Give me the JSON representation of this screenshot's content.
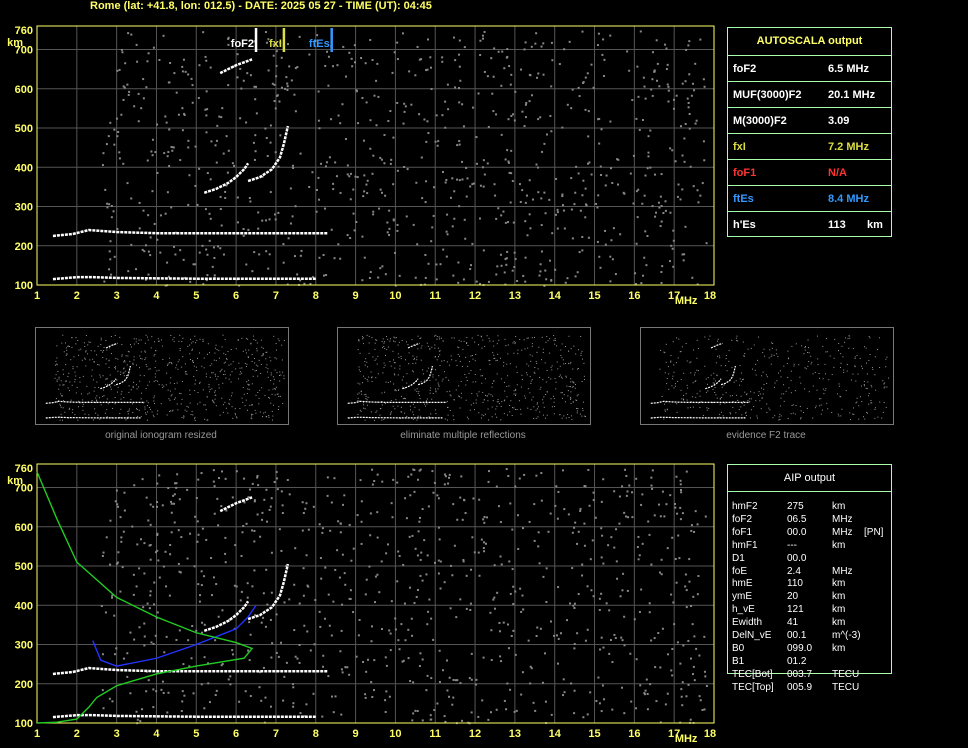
{
  "header": {
    "title": "Rome (lat: +41.8, lon: 012.5) - DATE: 2025 05 27 - TIME (UT): 04:45"
  },
  "autoscala": {
    "title": "AUTOSCALA output",
    "rows": [
      {
        "label": "foF2",
        "value": "6.5 MHz",
        "color": "#ffffff"
      },
      {
        "label": "MUF(3000)F2",
        "value": "20.1 MHz",
        "color": "#ffffff"
      },
      {
        "label": "M(3000)F2",
        "value": "3.09",
        "color": "#ffffff"
      },
      {
        "label": "fxI",
        "value": "7.2 MHz",
        "color": "#dddd44"
      },
      {
        "label": "foF1",
        "value": "N/A",
        "color": "#ff3333"
      },
      {
        "label": "ftEs",
        "value": "8.4 MHz",
        "color": "#3399ff"
      },
      {
        "label": "h'Es",
        "value": "113",
        "unit": "km",
        "color": "#ffffff"
      }
    ]
  },
  "aip": {
    "title": "AIP output",
    "rows": [
      {
        "name": "hmF2",
        "value": "275",
        "unit": "km",
        "extra": ""
      },
      {
        "name": "foF2",
        "value": "06.5",
        "unit": "MHz",
        "extra": ""
      },
      {
        "name": "foF1",
        "value": "00.0",
        "unit": "MHz",
        "extra": "[PN]"
      },
      {
        "name": "hmF1",
        "value": "---",
        "unit": "km",
        "extra": ""
      },
      {
        "name": "D1",
        "value": "00.0",
        "unit": "",
        "extra": ""
      },
      {
        "name": "foE",
        "value": "2.4",
        "unit": "MHz",
        "extra": ""
      },
      {
        "name": "hmE",
        "value": "110",
        "unit": "km",
        "extra": ""
      },
      {
        "name": "ymE",
        "value": "20",
        "unit": "km",
        "extra": ""
      },
      {
        "name": "h_vE",
        "value": "121",
        "unit": "km",
        "extra": ""
      },
      {
        "name": "Ewidth",
        "value": "41",
        "unit": "km",
        "extra": ""
      },
      {
        "name": "DelN_vE",
        "value": "00.1",
        "unit": "m^(-3)",
        "extra": ""
      },
      {
        "name": "B0",
        "value": "099.0",
        "unit": "km",
        "extra": ""
      },
      {
        "name": "B1",
        "value": "01.2",
        "unit": "",
        "extra": ""
      },
      {
        "name": "TEC[Bot]",
        "value": "003.7",
        "unit": "TECU",
        "extra": ""
      },
      {
        "name": "TEC[Top]",
        "value": "005.9",
        "unit": "TECU",
        "extra": ""
      }
    ]
  },
  "thumbnails": [
    {
      "caption": "original ionogram resized"
    },
    {
      "caption": "eliminate multiple reflections"
    },
    {
      "caption": "evidence F2 trace"
    }
  ],
  "chart_data": [
    {
      "type": "scatter",
      "title": "",
      "xlabel": "MHz",
      "ylabel": "km",
      "xlim": [
        1,
        18
      ],
      "ylim": [
        100,
        760
      ],
      "xticks": [
        "1",
        "2",
        "3",
        "4",
        "5",
        "6",
        "7",
        "8",
        "9",
        "10",
        "11",
        "12",
        "13",
        "14",
        "15",
        "16",
        "17",
        "18"
      ],
      "yticks": [
        "100",
        "200",
        "300",
        "400",
        "500",
        "600",
        "700",
        "760"
      ],
      "grid": true,
      "markers": [
        {
          "name": "foF2",
          "x": 6.5,
          "color": "#ffffff"
        },
        {
          "name": "fxI",
          "x": 7.2,
          "color": "#dddd44"
        },
        {
          "name": "ftEs",
          "x": 8.4,
          "color": "#3399ff"
        }
      ],
      "series": [
        {
          "values": [
            [
              1.4,
              115
            ],
            [
              2.0,
              120
            ],
            [
              2.4,
              120
            ],
            [
              3,
              118
            ],
            [
              4,
              117
            ],
            [
              5,
              116
            ],
            [
              6,
              116
            ],
            [
              7,
              116
            ],
            [
              8,
              116
            ]
          ],
          "color": "#ffffff"
        },
        {
          "values": [
            [
              1.4,
              225
            ],
            [
              1.9,
              230
            ],
            [
              2.3,
              240
            ],
            [
              3,
              235
            ],
            [
              4,
              232
            ],
            [
              5,
              232
            ],
            [
              6,
              232
            ],
            [
              7,
              232
            ],
            [
              8.3,
              232
            ]
          ],
          "color": "#ffffff"
        },
        {
          "values": [
            [
              5.2,
              335
            ],
            [
              5.5,
              345
            ],
            [
              5.8,
              360
            ],
            [
              6.0,
              375
            ],
            [
              6.2,
              395
            ],
            [
              6.3,
              410
            ]
          ],
          "color": "#ffffff"
        },
        {
          "values": [
            [
              6.3,
              365
            ],
            [
              6.6,
              375
            ],
            [
              6.9,
              395
            ],
            [
              7.1,
              425
            ],
            [
              7.2,
              460
            ],
            [
              7.3,
              505
            ]
          ],
          "color": "#ffffff"
        },
        {
          "values": [
            [
              5.6,
              640
            ],
            [
              6.0,
              660
            ],
            [
              6.4,
              675
            ]
          ],
          "color": "#ffffff"
        }
      ]
    },
    {
      "type": "scatter",
      "title": "",
      "xlabel": "MHz",
      "ylabel": "km",
      "xlim": [
        1,
        18
      ],
      "ylim": [
        100,
        760
      ],
      "xticks": [
        "1",
        "2",
        "3",
        "4",
        "5",
        "6",
        "7",
        "8",
        "9",
        "10",
        "11",
        "12",
        "13",
        "14",
        "15",
        "16",
        "17",
        "18"
      ],
      "yticks": [
        "100",
        "200",
        "300",
        "400",
        "500",
        "600",
        "700",
        "760"
      ],
      "grid": true,
      "series": [
        {
          "values": [
            [
              1.4,
              115
            ],
            [
              2.0,
              120
            ],
            [
              2.4,
              120
            ],
            [
              3,
              118
            ],
            [
              4,
              117
            ],
            [
              5,
              116
            ],
            [
              6,
              116
            ],
            [
              7,
              116
            ],
            [
              8,
              116
            ]
          ],
          "color": "#ffffff"
        },
        {
          "values": [
            [
              1.4,
              225
            ],
            [
              1.9,
              230
            ],
            [
              2.3,
              240
            ],
            [
              3,
              235
            ],
            [
              4,
              232
            ],
            [
              5,
              232
            ],
            [
              6,
              232
            ],
            [
              7,
              232
            ],
            [
              8.3,
              232
            ]
          ],
          "color": "#ffffff"
        },
        {
          "values": [
            [
              5.2,
              335
            ],
            [
              5.5,
              345
            ],
            [
              5.8,
              360
            ],
            [
              6.0,
              375
            ],
            [
              6.2,
              395
            ],
            [
              6.3,
              410
            ]
          ],
          "color": "#ffffff"
        },
        {
          "values": [
            [
              6.3,
              365
            ],
            [
              6.6,
              375
            ],
            [
              6.9,
              395
            ],
            [
              7.1,
              425
            ],
            [
              7.2,
              460
            ],
            [
              7.3,
              505
            ]
          ],
          "color": "#ffffff"
        },
        {
          "values": [
            [
              5.6,
              640
            ],
            [
              6.0,
              660
            ],
            [
              6.4,
              675
            ]
          ],
          "color": "#ffffff"
        },
        {
          "values": [
            [
              2.4,
              310
            ],
            [
              2.6,
              260
            ],
            [
              3,
              245
            ],
            [
              4,
              265
            ],
            [
              5,
              300
            ],
            [
              6,
              340
            ],
            [
              6.3,
              370
            ],
            [
              6.5,
              400
            ]
          ],
          "color": "#2233ff"
        },
        {
          "values": [
            [
              1.0,
              740
            ],
            [
              1.5,
              620
            ],
            [
              2,
              510
            ],
            [
              3,
              420
            ],
            [
              4,
              370
            ],
            [
              5,
              330
            ],
            [
              6,
              305
            ],
            [
              6.4,
              290
            ],
            [
              6.2,
              265
            ],
            [
              5,
              245
            ],
            [
              4,
              225
            ],
            [
              3,
              195
            ],
            [
              2.5,
              165
            ],
            [
              2.3,
              140
            ],
            [
              2,
              110
            ],
            [
              1.5,
              102
            ],
            [
              1.0,
              100
            ]
          ],
          "color": "#22cc22"
        }
      ]
    }
  ]
}
